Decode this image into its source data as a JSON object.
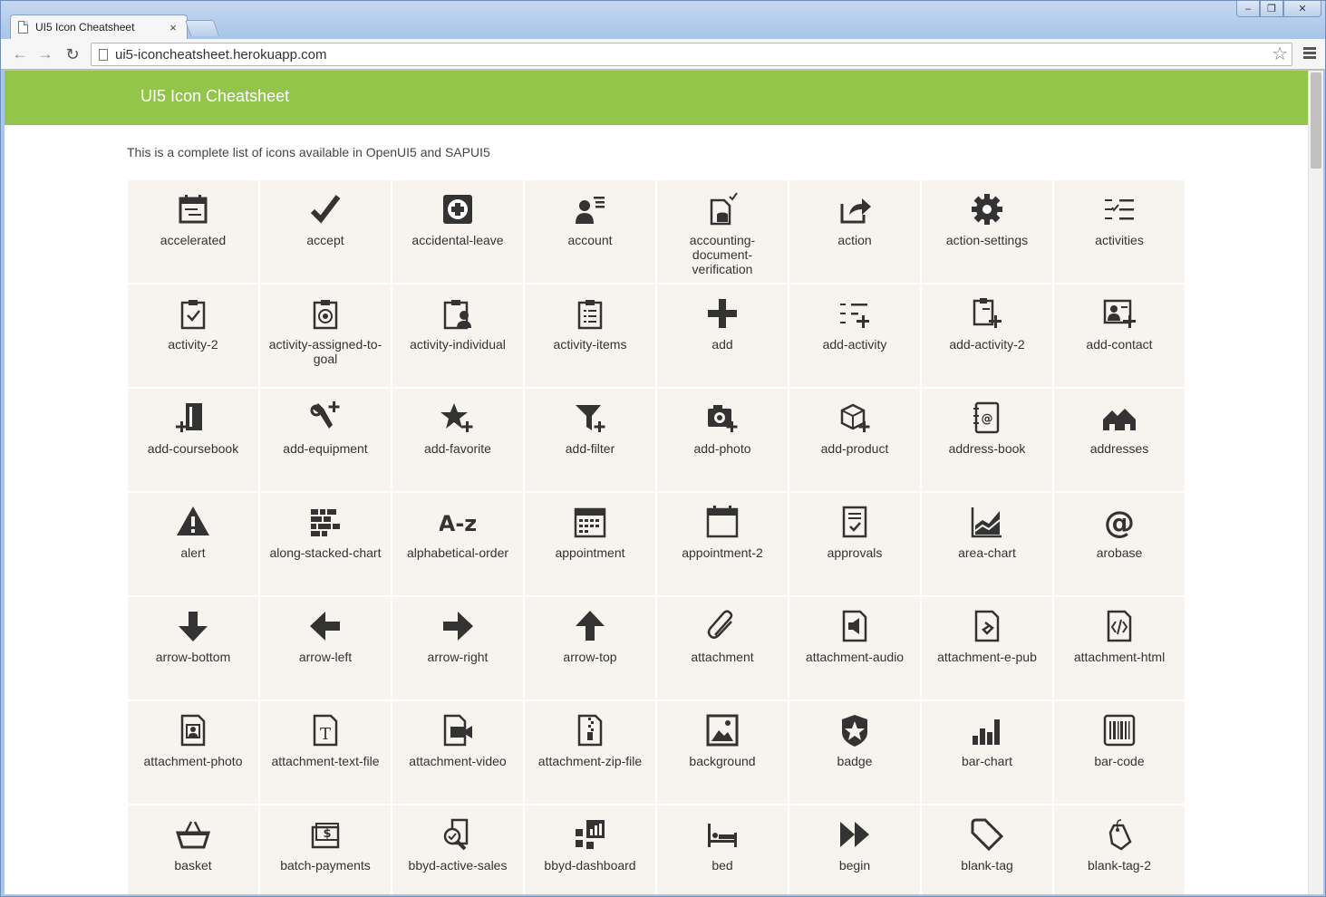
{
  "browser": {
    "tab_title": "UI5 Icon Cheatsheet",
    "tab_close": "×",
    "url": "ui5-iconcheatsheet.herokuapp.com",
    "win_minimize": "–",
    "win_restore": "❐",
    "win_close": "✕",
    "back_glyph": "←",
    "forward_glyph": "→",
    "reload_glyph": "↻",
    "star_glyph": "☆"
  },
  "header": {
    "title": "UI5 Icon Cheatsheet",
    "color": "#93c54b"
  },
  "intro": "This is a complete list of icons available in OpenUI5 and SAPUI5",
  "icons": [
    {
      "name": "accelerated",
      "label": "accelerated"
    },
    {
      "name": "accept",
      "label": "accept"
    },
    {
      "name": "accidental-leave",
      "label": "accidental-leave"
    },
    {
      "name": "account",
      "label": "account"
    },
    {
      "name": "accounting-document-verification",
      "label": "accounting-document-verification"
    },
    {
      "name": "action",
      "label": "action"
    },
    {
      "name": "action-settings",
      "label": "action-settings"
    },
    {
      "name": "activities",
      "label": "activities"
    },
    {
      "name": "activity-2",
      "label": "activity-2"
    },
    {
      "name": "activity-assigned-to-goal",
      "label": "activity-assigned-to-goal"
    },
    {
      "name": "activity-individual",
      "label": "activity-individual"
    },
    {
      "name": "activity-items",
      "label": "activity-items"
    },
    {
      "name": "add",
      "label": "add"
    },
    {
      "name": "add-activity",
      "label": "add-activity"
    },
    {
      "name": "add-activity-2",
      "label": "add-activity-2"
    },
    {
      "name": "add-contact",
      "label": "add-contact"
    },
    {
      "name": "add-coursebook",
      "label": "add-coursebook"
    },
    {
      "name": "add-equipment",
      "label": "add-equipment"
    },
    {
      "name": "add-favorite",
      "label": "add-favorite"
    },
    {
      "name": "add-filter",
      "label": "add-filter"
    },
    {
      "name": "add-photo",
      "label": "add-photo"
    },
    {
      "name": "add-product",
      "label": "add-product"
    },
    {
      "name": "address-book",
      "label": "address-book"
    },
    {
      "name": "addresses",
      "label": "addresses"
    },
    {
      "name": "alert",
      "label": "alert"
    },
    {
      "name": "along-stacked-chart",
      "label": "along-stacked-chart"
    },
    {
      "name": "alphabetical-order",
      "label": "alphabetical-order"
    },
    {
      "name": "appointment",
      "label": "appointment"
    },
    {
      "name": "appointment-2",
      "label": "appointment-2"
    },
    {
      "name": "approvals",
      "label": "approvals"
    },
    {
      "name": "area-chart",
      "label": "area-chart"
    },
    {
      "name": "arobase",
      "label": "arobase"
    },
    {
      "name": "arrow-bottom",
      "label": "arrow-bottom"
    },
    {
      "name": "arrow-left",
      "label": "arrow-left"
    },
    {
      "name": "arrow-right",
      "label": "arrow-right"
    },
    {
      "name": "arrow-top",
      "label": "arrow-top"
    },
    {
      "name": "attachment",
      "label": "attachment"
    },
    {
      "name": "attachment-audio",
      "label": "attachment-audio"
    },
    {
      "name": "attachment-e-pub",
      "label": "attachment-e-pub"
    },
    {
      "name": "attachment-html",
      "label": "attachment-html"
    },
    {
      "name": "attachment-photo",
      "label": "attachment-photo"
    },
    {
      "name": "attachment-text-file",
      "label": "attachment-text-file"
    },
    {
      "name": "attachment-video",
      "label": "attachment-video"
    },
    {
      "name": "attachment-zip-file",
      "label": "attachment-zip-file"
    },
    {
      "name": "background",
      "label": "background"
    },
    {
      "name": "badge",
      "label": "badge"
    },
    {
      "name": "bar-chart",
      "label": "bar-chart"
    },
    {
      "name": "bar-code",
      "label": "bar-code"
    },
    {
      "name": "basket",
      "label": "basket"
    },
    {
      "name": "batch-payments",
      "label": "batch-payments"
    },
    {
      "name": "bbyd-active-sales",
      "label": "bbyd-active-sales"
    },
    {
      "name": "bbyd-dashboard",
      "label": "bbyd-dashboard"
    },
    {
      "name": "bed",
      "label": "bed"
    },
    {
      "name": "begin",
      "label": "begin"
    },
    {
      "name": "blank-tag",
      "label": "blank-tag"
    },
    {
      "name": "blank-tag-2",
      "label": "blank-tag-2"
    }
  ]
}
